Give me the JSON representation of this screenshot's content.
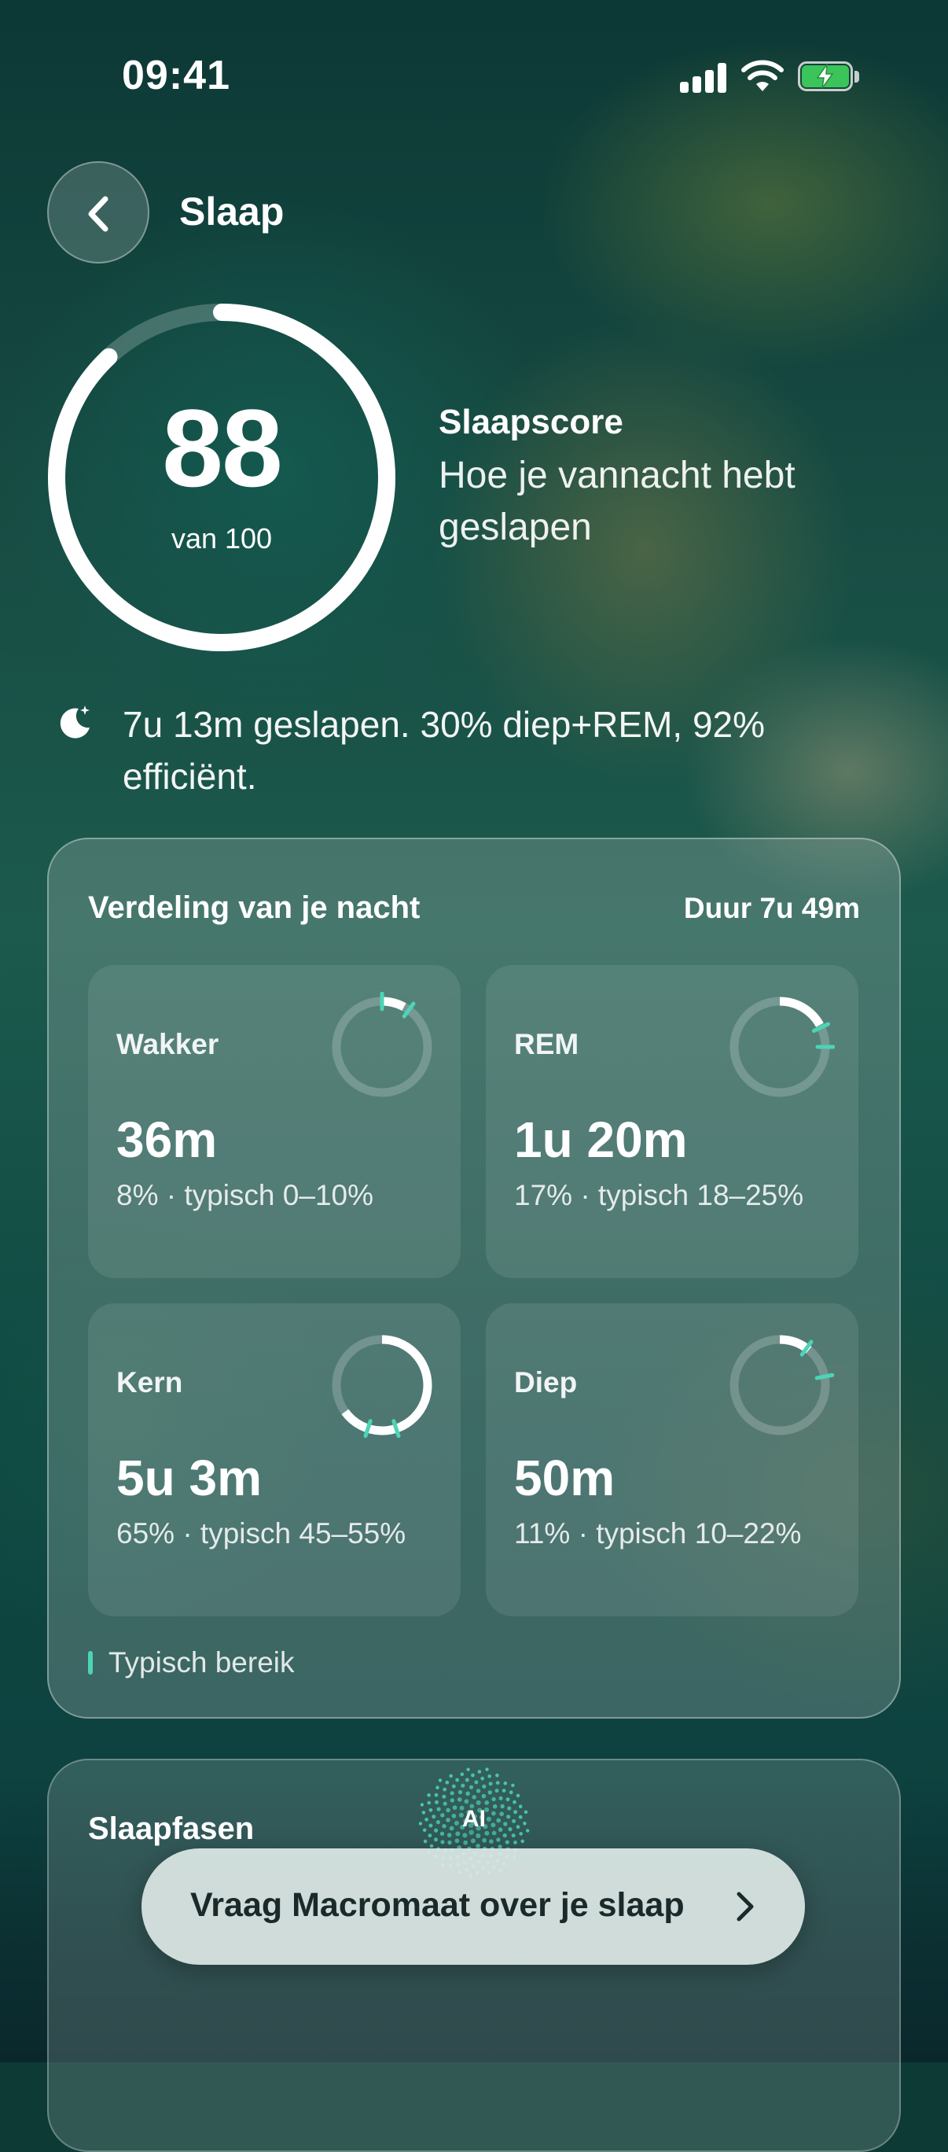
{
  "status_bar": {
    "time": "09:41"
  },
  "header": {
    "title": "Slaap",
    "back_icon": "chevron-left-icon"
  },
  "score": {
    "value": "88",
    "max_label": "van 100",
    "fraction": 0.88,
    "label": "Slaapscore",
    "description": "Hoe je vannacht hebt geslapen"
  },
  "summary": {
    "icon": "moon-stars-icon",
    "text": "7u 13m geslapen. 30% diep+REM, 92% efficiënt."
  },
  "distribution": {
    "title": "Verdeling van je nacht",
    "duration": "Duur 7u 49m",
    "accent_color": "#4cd4b6",
    "stages": [
      {
        "name": "Wakker",
        "value": "36m",
        "detail": "8% · typisch 0–10%",
        "percent": 8,
        "typical_min": 0,
        "typical_max": 10
      },
      {
        "name": "REM",
        "value": "1u 20m",
        "detail": "17% · typisch 18–25%",
        "percent": 17,
        "typical_min": 18,
        "typical_max": 25
      },
      {
        "name": "Kern",
        "value": "5u 3m",
        "detail": "65% · typisch 45–55%",
        "percent": 65,
        "typical_min": 45,
        "typical_max": 55
      },
      {
        "name": "Diep",
        "value": "50m",
        "detail": "11% · typisch 10–22%",
        "percent": 11,
        "typical_min": 10,
        "typical_max": 22
      }
    ],
    "legend": "Typisch bereik"
  },
  "phases": {
    "title": "Slaapfasen"
  },
  "assistant": {
    "badge": "AI",
    "cta_label": "Vraag Macromaat over je slaap",
    "cta_icon": "chevron-right-icon"
  }
}
